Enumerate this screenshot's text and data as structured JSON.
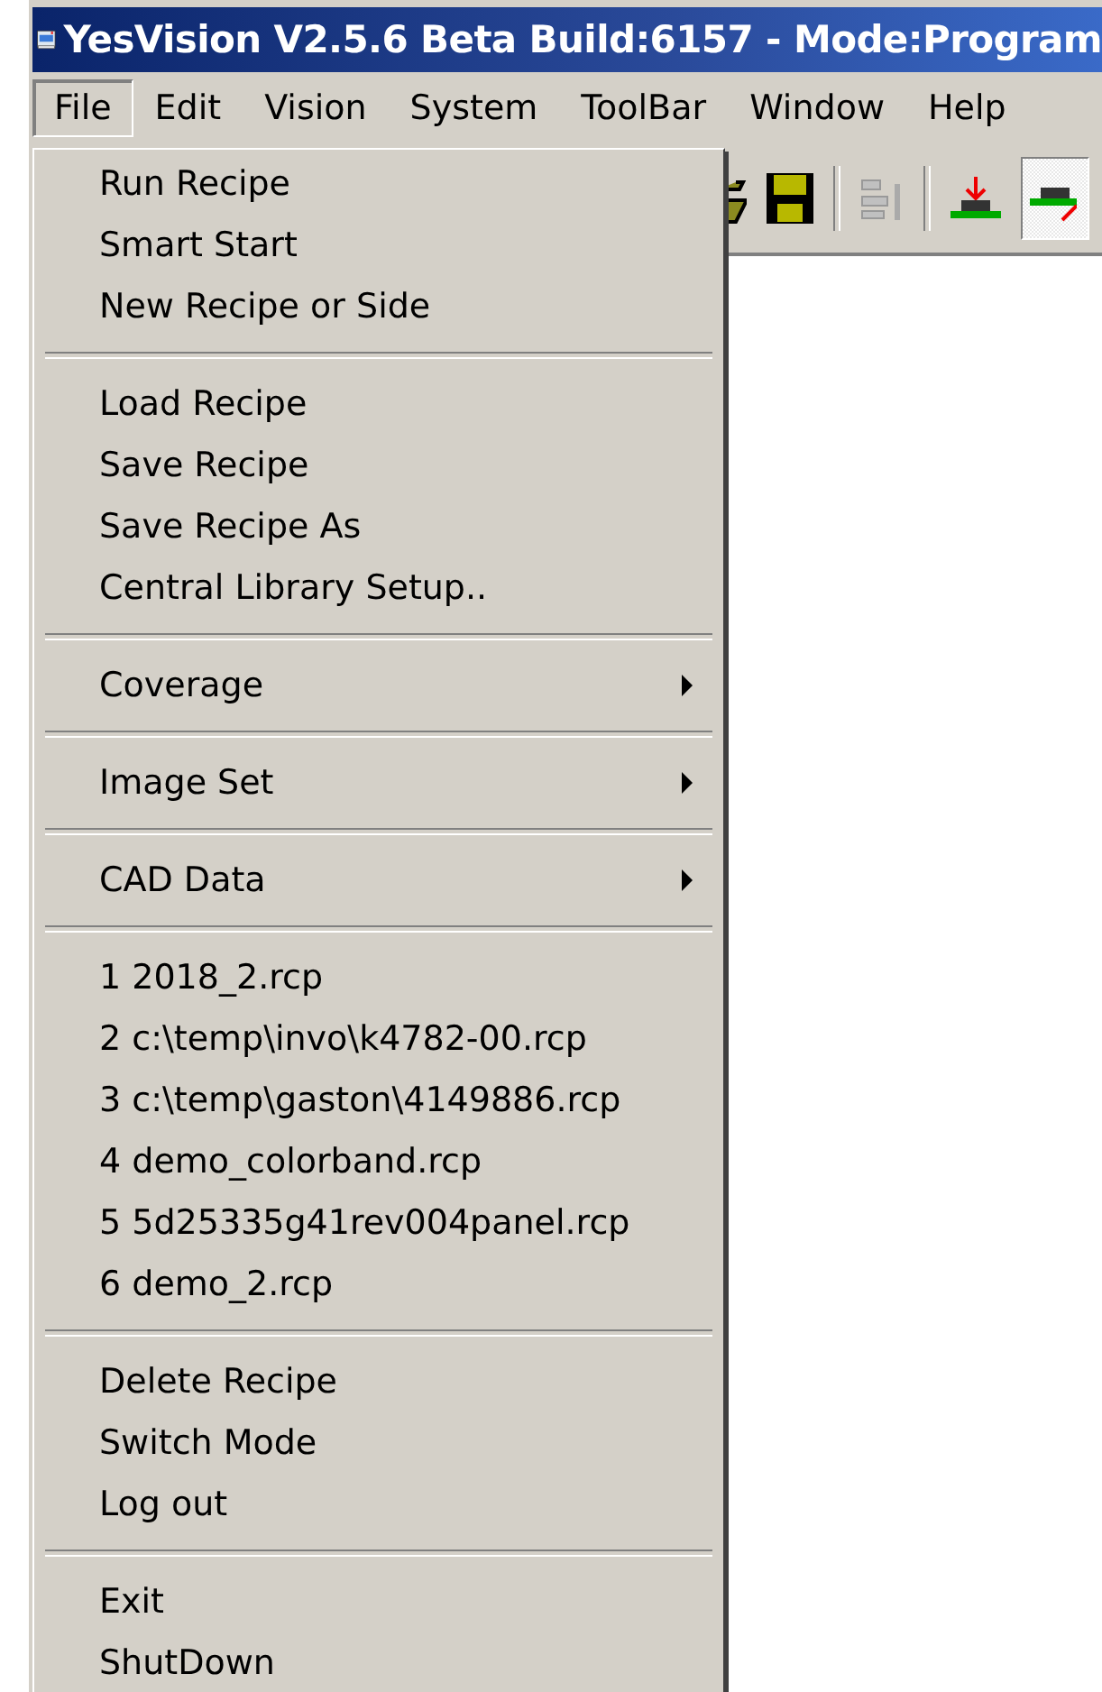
{
  "window": {
    "title": "YesVision V2.5.6 Beta Build:6157 - Mode:Program"
  },
  "menubar": [
    {
      "label": "File",
      "selected": true
    },
    {
      "label": "Edit",
      "selected": false
    },
    {
      "label": "Vision",
      "selected": false
    },
    {
      "label": "System",
      "selected": false
    },
    {
      "label": "ToolBar",
      "selected": false
    },
    {
      "label": "Window",
      "selected": false
    },
    {
      "label": "Help",
      "selected": false
    }
  ],
  "file_menu": {
    "groups": [
      [
        {
          "label": "Run Recipe",
          "kind": "plain"
        },
        {
          "label": "Smart Start",
          "kind": "plain"
        },
        {
          "label": "New Recipe or Side",
          "kind": "plain"
        }
      ],
      [
        {
          "label": "Load Recipe",
          "kind": "plain"
        },
        {
          "label": "Save Recipe",
          "kind": "plain"
        },
        {
          "label": "Save Recipe As",
          "kind": "plain"
        },
        {
          "label": "Central Library Setup..",
          "kind": "plain"
        }
      ],
      [
        {
          "label": "Coverage",
          "kind": "submenu"
        }
      ],
      [
        {
          "label": "Image Set",
          "kind": "submenu"
        }
      ],
      [
        {
          "label": "CAD Data",
          "kind": "submenu"
        }
      ],
      [
        {
          "label": "1 2018_2.rcp",
          "kind": "plain"
        },
        {
          "label": "2 c:\\temp\\invo\\k4782-00.rcp",
          "kind": "plain"
        },
        {
          "label": "3 c:\\temp\\gaston\\4149886.rcp",
          "kind": "plain"
        },
        {
          "label": "4 demo_colorband.rcp",
          "kind": "plain"
        },
        {
          "label": "5 5d25335g41rev004panel.rcp",
          "kind": "plain"
        },
        {
          "label": "6 demo_2.rcp",
          "kind": "plain"
        }
      ],
      [
        {
          "label": "Delete Recipe",
          "kind": "plain"
        },
        {
          "label": "Switch Mode",
          "kind": "plain"
        },
        {
          "label": "Log out",
          "kind": "plain"
        }
      ],
      [
        {
          "label": "Exit",
          "kind": "plain"
        },
        {
          "label": "ShutDown",
          "kind": "plain"
        }
      ]
    ]
  }
}
